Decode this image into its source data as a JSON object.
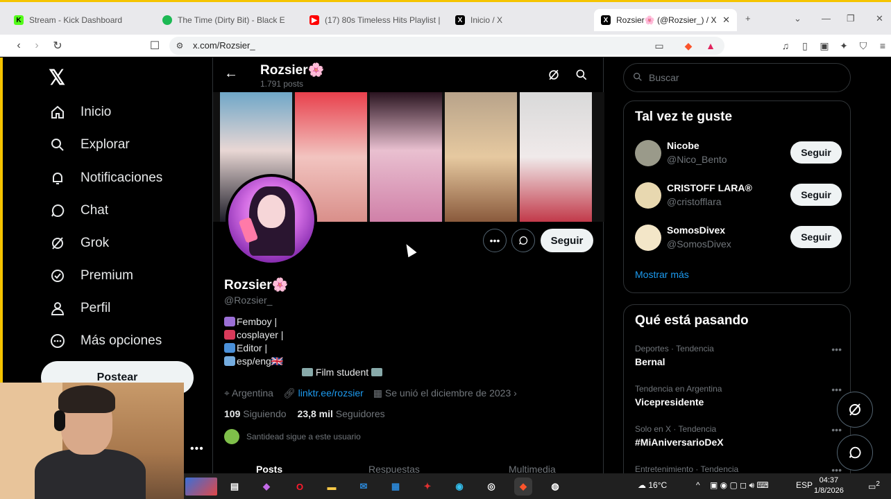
{
  "browser": {
    "tabs": [
      {
        "label": "Stream - Kick Dashboard",
        "favicon": "kick-icon",
        "color": "#53fc18"
      },
      {
        "label": "The Time (Dirty Bit) - Black E",
        "favicon": "spotify-icon",
        "color": "#1db954"
      },
      {
        "label": "(17) 80s Timeless Hits Playlist | ",
        "favicon": "youtube-icon",
        "color": "#ff0000"
      },
      {
        "label": "Inicio / X",
        "favicon": "x-icon",
        "color": "#000000"
      },
      {
        "label": "Rozsier🌸 (@Rozsier_) / X",
        "favicon": "x-icon",
        "color": "#000000"
      }
    ],
    "url": "x.com/Rozsier_"
  },
  "sidebar": {
    "items": [
      {
        "label": "Inicio",
        "icon": "home-icon"
      },
      {
        "label": "Explorar",
        "icon": "search-icon"
      },
      {
        "label": "Notificaciones",
        "icon": "bell-icon"
      },
      {
        "label": "Chat",
        "icon": "chat-icon"
      },
      {
        "label": "Grok",
        "icon": "grok-icon"
      },
      {
        "label": "Premium",
        "icon": "verified-icon"
      },
      {
        "label": "Perfil",
        "icon": "person-icon"
      },
      {
        "label": "Más opciones",
        "icon": "more-circle-icon"
      }
    ],
    "post_label": "Postear"
  },
  "profile": {
    "header_name": "Rozsier🌸",
    "header_posts": "1.791 posts",
    "name": "Rozsier🌸",
    "handle": "@Rozsier_",
    "bio_lines": [
      "Femboy |",
      "cosplayer |",
      "Editor |",
      "esp/eng🇬🇧"
    ],
    "bio_film": "Film student",
    "location": "Argentina",
    "link": "linktr.ee/rozsier",
    "joined": "Se unió el diciembre de 2023",
    "following_count": "109",
    "following_label": "Siguiendo",
    "followers_count": "23,8 mil",
    "followers_label": "Seguidores",
    "followed_by": "Santidead sigue a este usuario",
    "follow_label": "Seguir",
    "tabs": [
      "Posts",
      "Respuestas",
      "Multimedia"
    ]
  },
  "right": {
    "search_placeholder": "Buscar",
    "suggest_title": "Tal vez te guste",
    "suggestions": [
      {
        "name": "Nicobe",
        "handle": "@Nico_Bento",
        "button": "Seguir",
        "color": "#9a9a8a"
      },
      {
        "name": "CRISTOFF LARA®",
        "handle": "@cristofflara",
        "button": "Seguir",
        "color": "#e8d8b0"
      },
      {
        "name": "SomosDivex",
        "handle": "@SomosDivex",
        "button": "Seguir",
        "color": "#f3e6c8"
      }
    ],
    "show_more": "Mostrar más",
    "trends_title": "Qué está pasando",
    "trends": [
      {
        "context": "Deportes · Tendencia",
        "title": "Bernal"
      },
      {
        "context": "Tendencia en Argentina",
        "title": "Vicepresidente"
      },
      {
        "context": "Solo en X · Tendencia",
        "title": "#MiAniversarioDeX"
      },
      {
        "context": "Entretenimiento · Tendencia",
        "title": ""
      }
    ]
  },
  "taskbar": {
    "weather": "16°C",
    "language": "ESP",
    "time": "04:37",
    "date": "1/8/2026",
    "notifications": "2"
  }
}
